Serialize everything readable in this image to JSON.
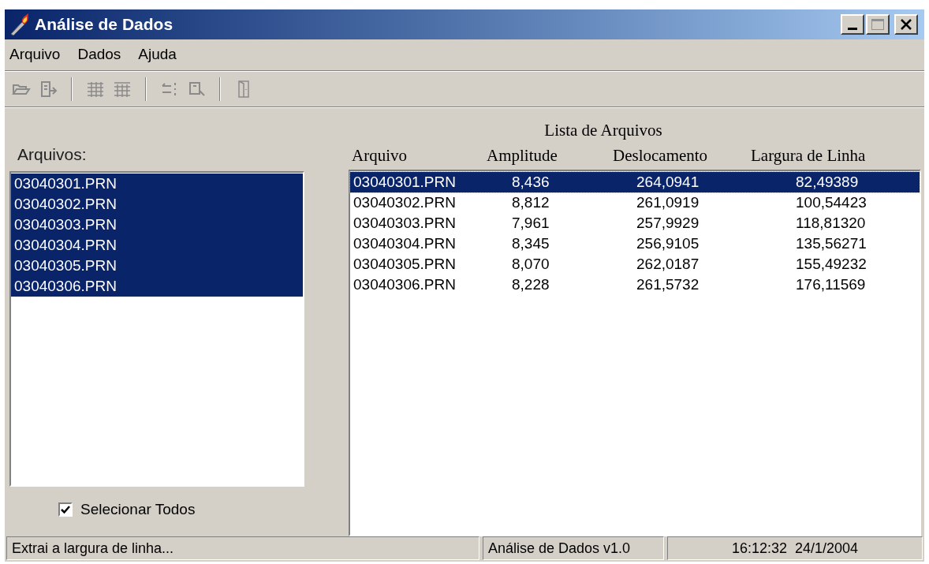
{
  "window": {
    "title": "Análise de Dados"
  },
  "menu": [
    "Arquivo",
    "Dados",
    "Ajuda"
  ],
  "files_panel": {
    "label": "Arquivos:",
    "items": [
      {
        "name": "03040301.PRN",
        "selected": true
      },
      {
        "name": "03040302.PRN",
        "selected": true
      },
      {
        "name": "03040303.PRN",
        "selected": true
      },
      {
        "name": "03040304.PRN",
        "selected": true
      },
      {
        "name": "03040305.PRN",
        "selected": true
      },
      {
        "name": "03040306.PRN",
        "selected": true
      }
    ],
    "select_all": {
      "label": "Selecionar Todos",
      "checked": true
    }
  },
  "results": {
    "title": "Lista de Arquivos",
    "columns": [
      "Arquivo",
      "Amplitude",
      "Deslocamento",
      "Largura de Linha"
    ],
    "rows": [
      {
        "cells": [
          "03040301.PRN",
          "8,436",
          "264,0941",
          "82,49389"
        ],
        "selected": true
      },
      {
        "cells": [
          "03040302.PRN",
          "8,812",
          "261,0919",
          "100,54423"
        ],
        "selected": false
      },
      {
        "cells": [
          "03040303.PRN",
          "7,961",
          "257,9929",
          "118,81320"
        ],
        "selected": false
      },
      {
        "cells": [
          "03040304.PRN",
          "8,345",
          "256,9105",
          "135,56271"
        ],
        "selected": false
      },
      {
        "cells": [
          "03040305.PRN",
          "8,070",
          "262,0187",
          "155,49232"
        ],
        "selected": false
      },
      {
        "cells": [
          "03040306.PRN",
          "8,228",
          "261,5732",
          "176,11569"
        ],
        "selected": false
      }
    ]
  },
  "status_bar": [
    "Extrai a largura de linha...",
    "Análise de Dados v1.0",
    "16:12:32  24/1/2004"
  ]
}
